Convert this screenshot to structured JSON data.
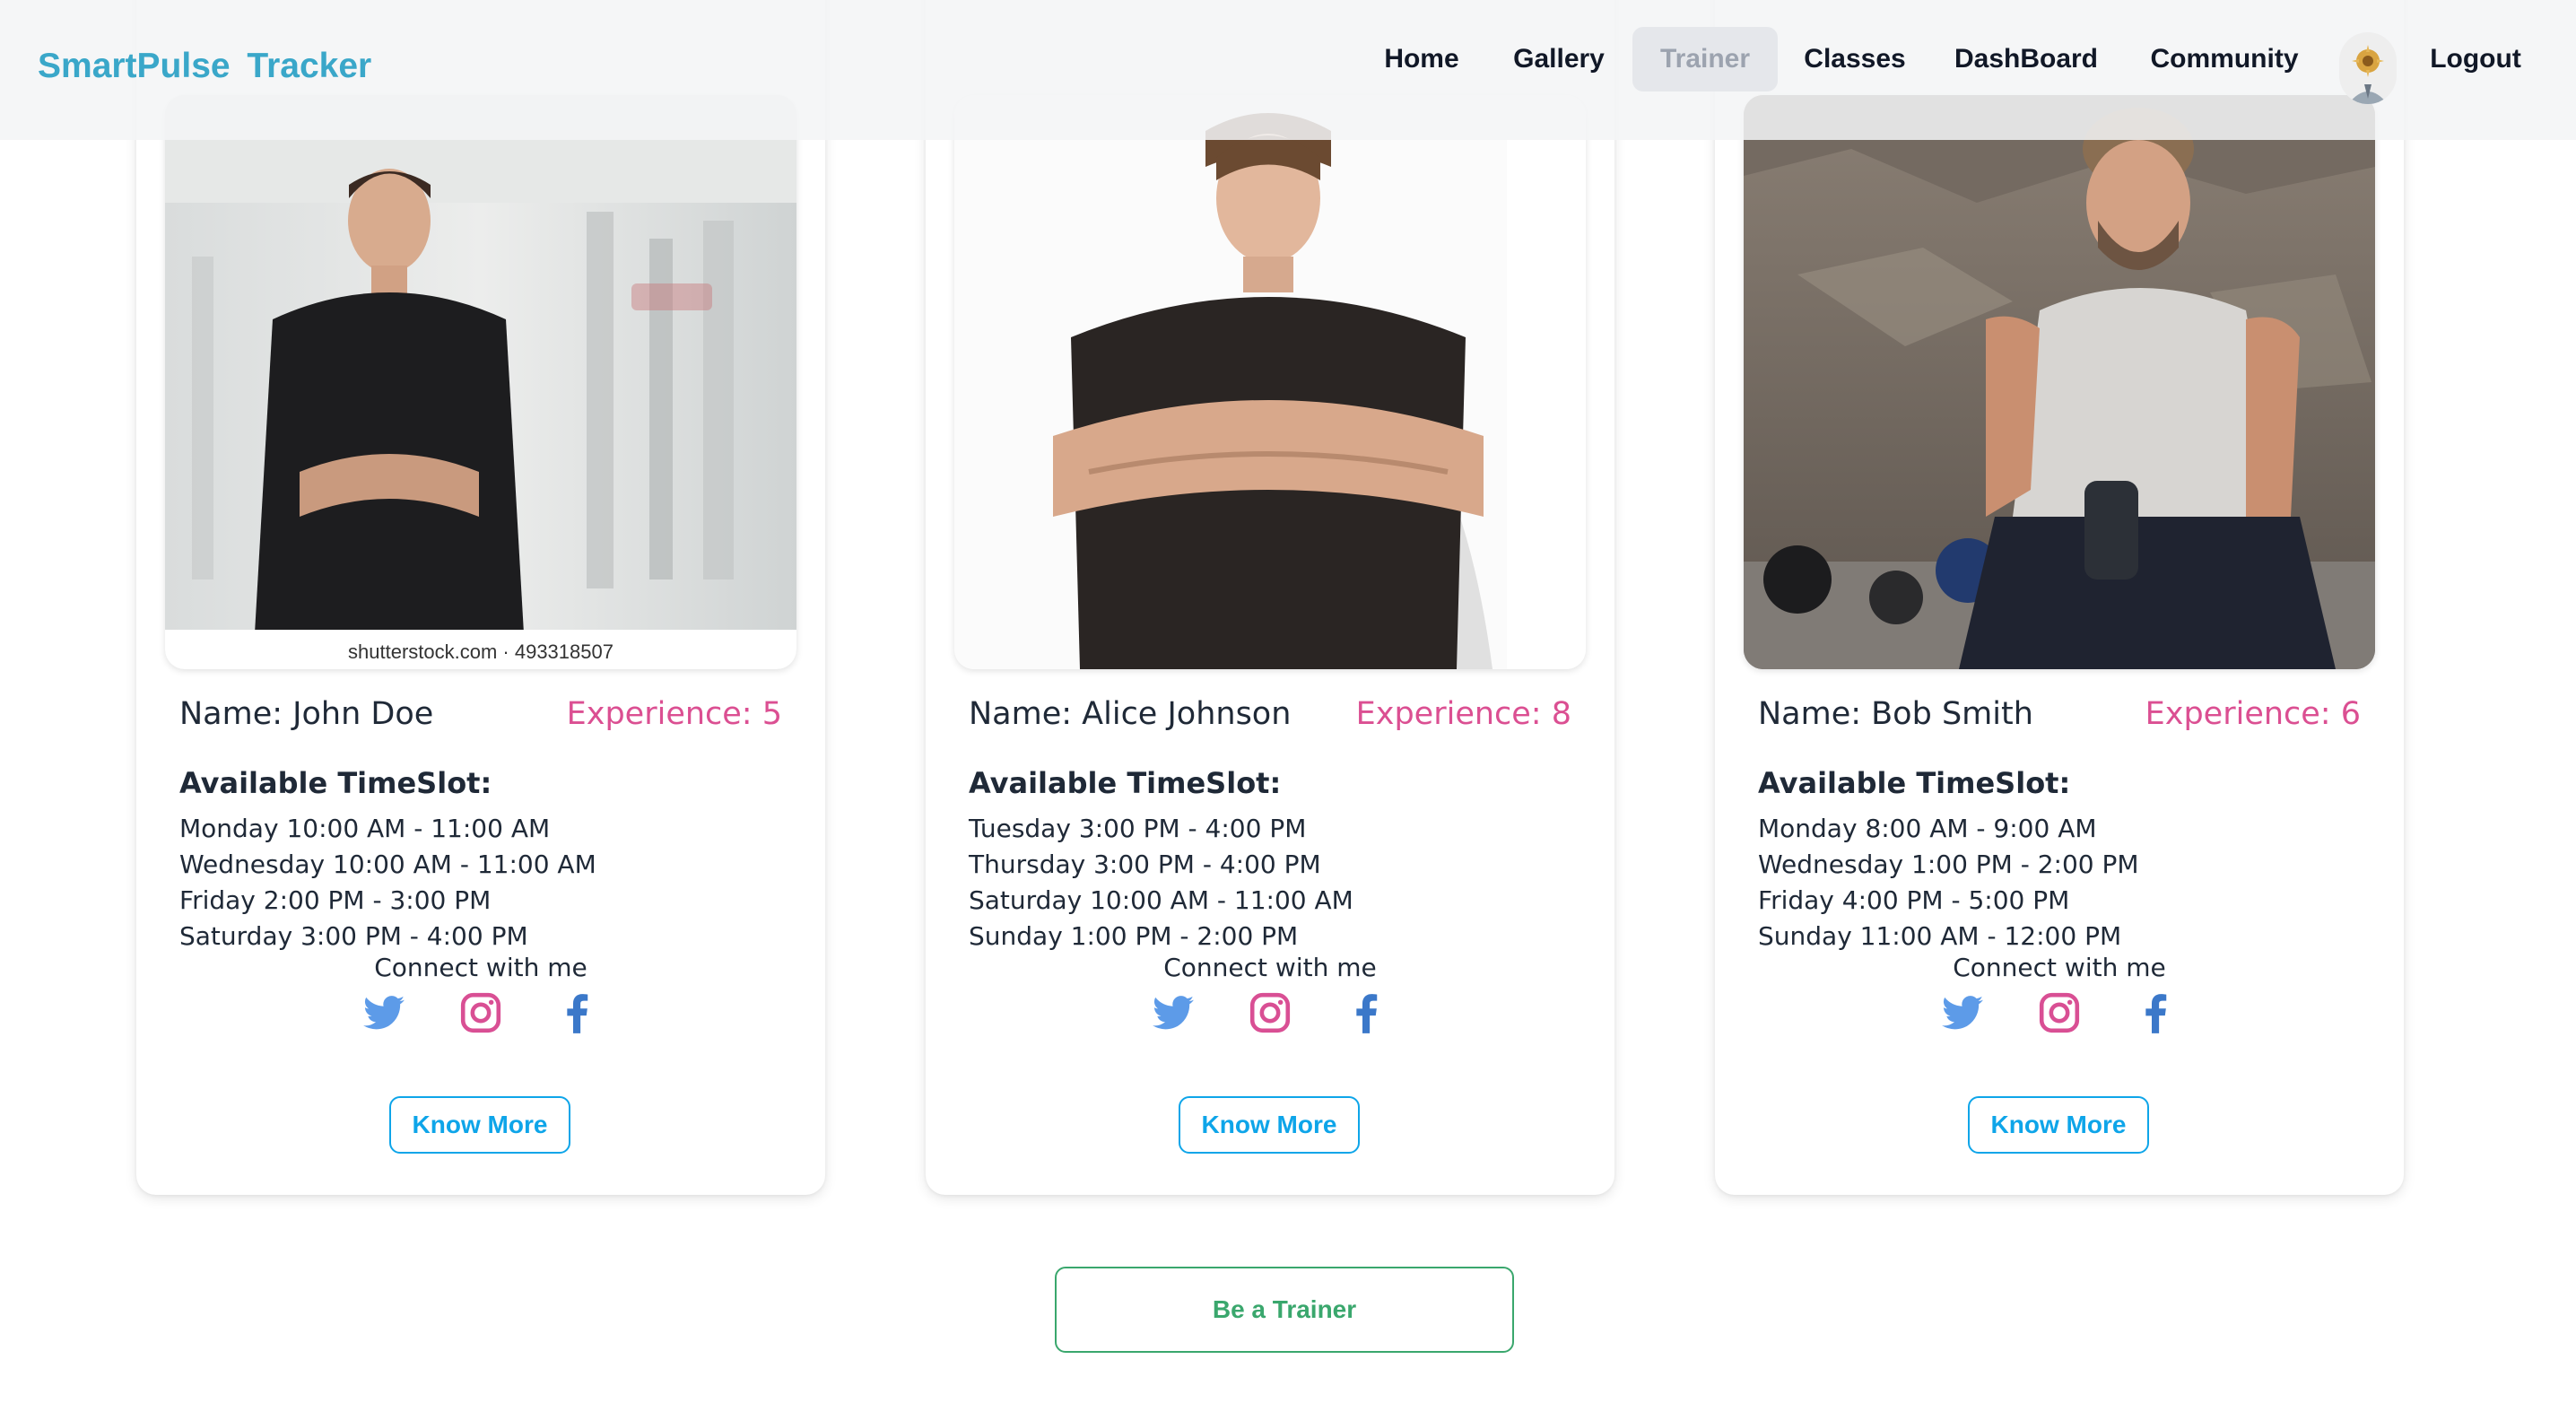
{
  "app": {
    "brand": "SmartPulse Tracker",
    "nav": [
      "Home",
      "Gallery",
      "Trainer",
      "Classes",
      "DashBoard",
      "Community",
      "Logout"
    ],
    "active_nav": "Trainer"
  },
  "trainers": [
    {
      "name": "Name: John Doe",
      "experience": "Experience: 5",
      "timeslot_title": "Available TimeSlot:",
      "slots": [
        "Monday 10:00 AM - 11:00 AM",
        "Wednesday 10:00 AM - 11:00 AM",
        "Friday 2:00 PM - 3:00 PM",
        "Saturday 3:00 PM - 4:00 PM"
      ],
      "photo_watermark": "shutterstock.com · 493318507",
      "connect": "Connect with me",
      "button": "Know More"
    },
    {
      "name": "Name: Alice Johnson",
      "experience": "Experience: 8",
      "timeslot_title": "Available TimeSlot:",
      "slots": [
        "Tuesday 3:00 PM - 4:00 PM",
        "Thursday 3:00 PM - 4:00 PM",
        "Saturday 10:00 AM - 11:00 AM",
        "Sunday 1:00 PM - 2:00 PM"
      ],
      "connect": "Connect with me",
      "button": "Know More"
    },
    {
      "name": "Name: Bob Smith",
      "experience": "Experience: 6",
      "timeslot_title": "Available TimeSlot:",
      "slots": [
        "Monday 8:00 AM - 9:00 AM",
        "Wednesday 1:00 PM - 2:00 PM",
        "Friday 4:00 PM - 5:00 PM",
        "Sunday 11:00 AM - 12:00 PM"
      ],
      "connect": "Connect with me",
      "button": "Know More"
    }
  ],
  "icons": [
    "twitter-icon",
    "instagram-icon",
    "facebook-icon"
  ],
  "cta": {
    "label": "Be a Trainer"
  },
  "colors": {
    "brand": "#3aa7c9",
    "experience": "#db4f92",
    "twitter": "#5d9be8",
    "instagram": "#d94f94",
    "facebook": "#3b78c9",
    "know_more": "#0ea5e9",
    "cta": "#3aa76d",
    "nav_active": "#9ca3af"
  }
}
